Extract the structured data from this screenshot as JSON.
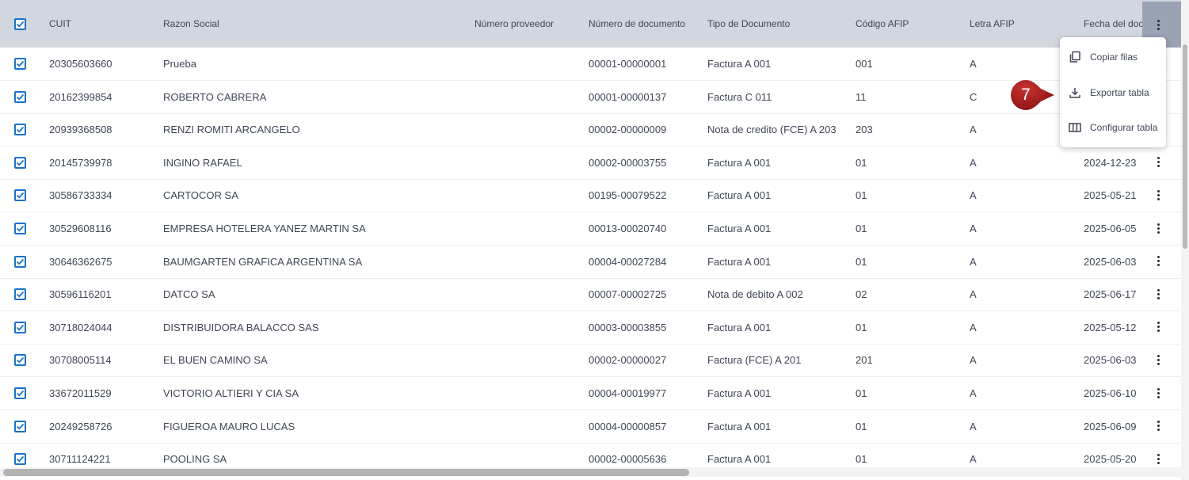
{
  "columns": {
    "cuit": "CUIT",
    "razon_social": "Razon Social",
    "numero_proveedor": "Número proveedor",
    "numero_documento": "Número de documento",
    "tipo_documento": "Tipo de Documento",
    "codigo_afip": "Código AFIP",
    "letra_afip": "Letra AFIP",
    "fecha_documento": "Fecha del doc"
  },
  "rows": [
    {
      "cuit": "20305603660",
      "razon_social": "Prueba",
      "numero_proveedor": "",
      "numero_documento": "00001-00000001",
      "tipo_documento": "Factura A 001",
      "codigo_afip": "001",
      "letra_afip": "A",
      "fecha": ""
    },
    {
      "cuit": "20162399854",
      "razon_social": "ROBERTO CABRERA",
      "numero_proveedor": "",
      "numero_documento": "00001-00000137",
      "tipo_documento": "Factura C 011",
      "codigo_afip": "11",
      "letra_afip": "C",
      "fecha": ""
    },
    {
      "cuit": "20939368508",
      "razon_social": "RENZI ROMITI ARCANGELO",
      "numero_proveedor": "",
      "numero_documento": "00002-00000009",
      "tipo_documento": "Nota de credito (FCE) A 203",
      "codigo_afip": "203",
      "letra_afip": "A",
      "fecha": ""
    },
    {
      "cuit": "20145739978",
      "razon_social": "INGINO RAFAEL",
      "numero_proveedor": "",
      "numero_documento": "00002-00003755",
      "tipo_documento": "Factura A 001",
      "codigo_afip": "01",
      "letra_afip": "A",
      "fecha": "2024-12-23"
    },
    {
      "cuit": "30586733334",
      "razon_social": "CARTOCOR SA",
      "numero_proveedor": "",
      "numero_documento": "00195-00079522",
      "tipo_documento": "Factura A 001",
      "codigo_afip": "01",
      "letra_afip": "A",
      "fecha": "2025-05-21"
    },
    {
      "cuit": "30529608116",
      "razon_social": "EMPRESA HOTELERA YANEZ MARTIN SA",
      "numero_proveedor": "",
      "numero_documento": "00013-00020740",
      "tipo_documento": "Factura A 001",
      "codigo_afip": "01",
      "letra_afip": "A",
      "fecha": "2025-06-05"
    },
    {
      "cuit": "30646362675",
      "razon_social": "BAUMGARTEN GRAFICA ARGENTINA SA",
      "numero_proveedor": "",
      "numero_documento": "00004-00027284",
      "tipo_documento": "Factura A 001",
      "codigo_afip": "01",
      "letra_afip": "A",
      "fecha": "2025-06-03"
    },
    {
      "cuit": "30596116201",
      "razon_social": "DATCO SA",
      "numero_proveedor": "",
      "numero_documento": "00007-00002725",
      "tipo_documento": "Nota de debito A 002",
      "codigo_afip": "02",
      "letra_afip": "A",
      "fecha": "2025-06-17"
    },
    {
      "cuit": "30718024044",
      "razon_social": "DISTRIBUIDORA BALACCO SAS",
      "numero_proveedor": "",
      "numero_documento": "00003-00003855",
      "tipo_documento": "Factura A 001",
      "codigo_afip": "01",
      "letra_afip": "A",
      "fecha": "2025-05-12"
    },
    {
      "cuit": "30708005114",
      "razon_social": "EL BUEN CAMINO SA",
      "numero_proveedor": "",
      "numero_documento": "00002-00000027",
      "tipo_documento": "Factura (FCE) A 201",
      "codigo_afip": "201",
      "letra_afip": "A",
      "fecha": "2025-06-03"
    },
    {
      "cuit": "33672011529",
      "razon_social": "VICTORIO ALTIERI Y CIA SA",
      "numero_proveedor": "",
      "numero_documento": "00004-00019977",
      "tipo_documento": "Factura A 001",
      "codigo_afip": "01",
      "letra_afip": "A",
      "fecha": "2025-06-10"
    },
    {
      "cuit": "20249258726",
      "razon_social": "FIGUEROA MAURO LUCAS",
      "numero_proveedor": "",
      "numero_documento": "00004-00000857",
      "tipo_documento": "Factura A 001",
      "codigo_afip": "01",
      "letra_afip": "A",
      "fecha": "2025-06-09"
    },
    {
      "cuit": "30711124221",
      "razon_social": "POOLING SA",
      "numero_proveedor": "",
      "numero_documento": "00002-00005636",
      "tipo_documento": "Factura A 001",
      "codigo_afip": "01",
      "letra_afip": "A",
      "fecha": "2025-05-20"
    }
  ],
  "menu": {
    "items": [
      {
        "label": "Copiar filas",
        "icon": "copy-icon"
      },
      {
        "label": "Exportar tabla",
        "icon": "download-icon"
      },
      {
        "label": "Configurar tabla",
        "icon": "columns-icon"
      }
    ]
  },
  "step_badge": {
    "label": "7",
    "color": "#a51c1c"
  },
  "colors": {
    "header_bg": "#d2d6de",
    "checkbox": "#1a73c9",
    "header_menu_active": "#9aa3b4"
  }
}
